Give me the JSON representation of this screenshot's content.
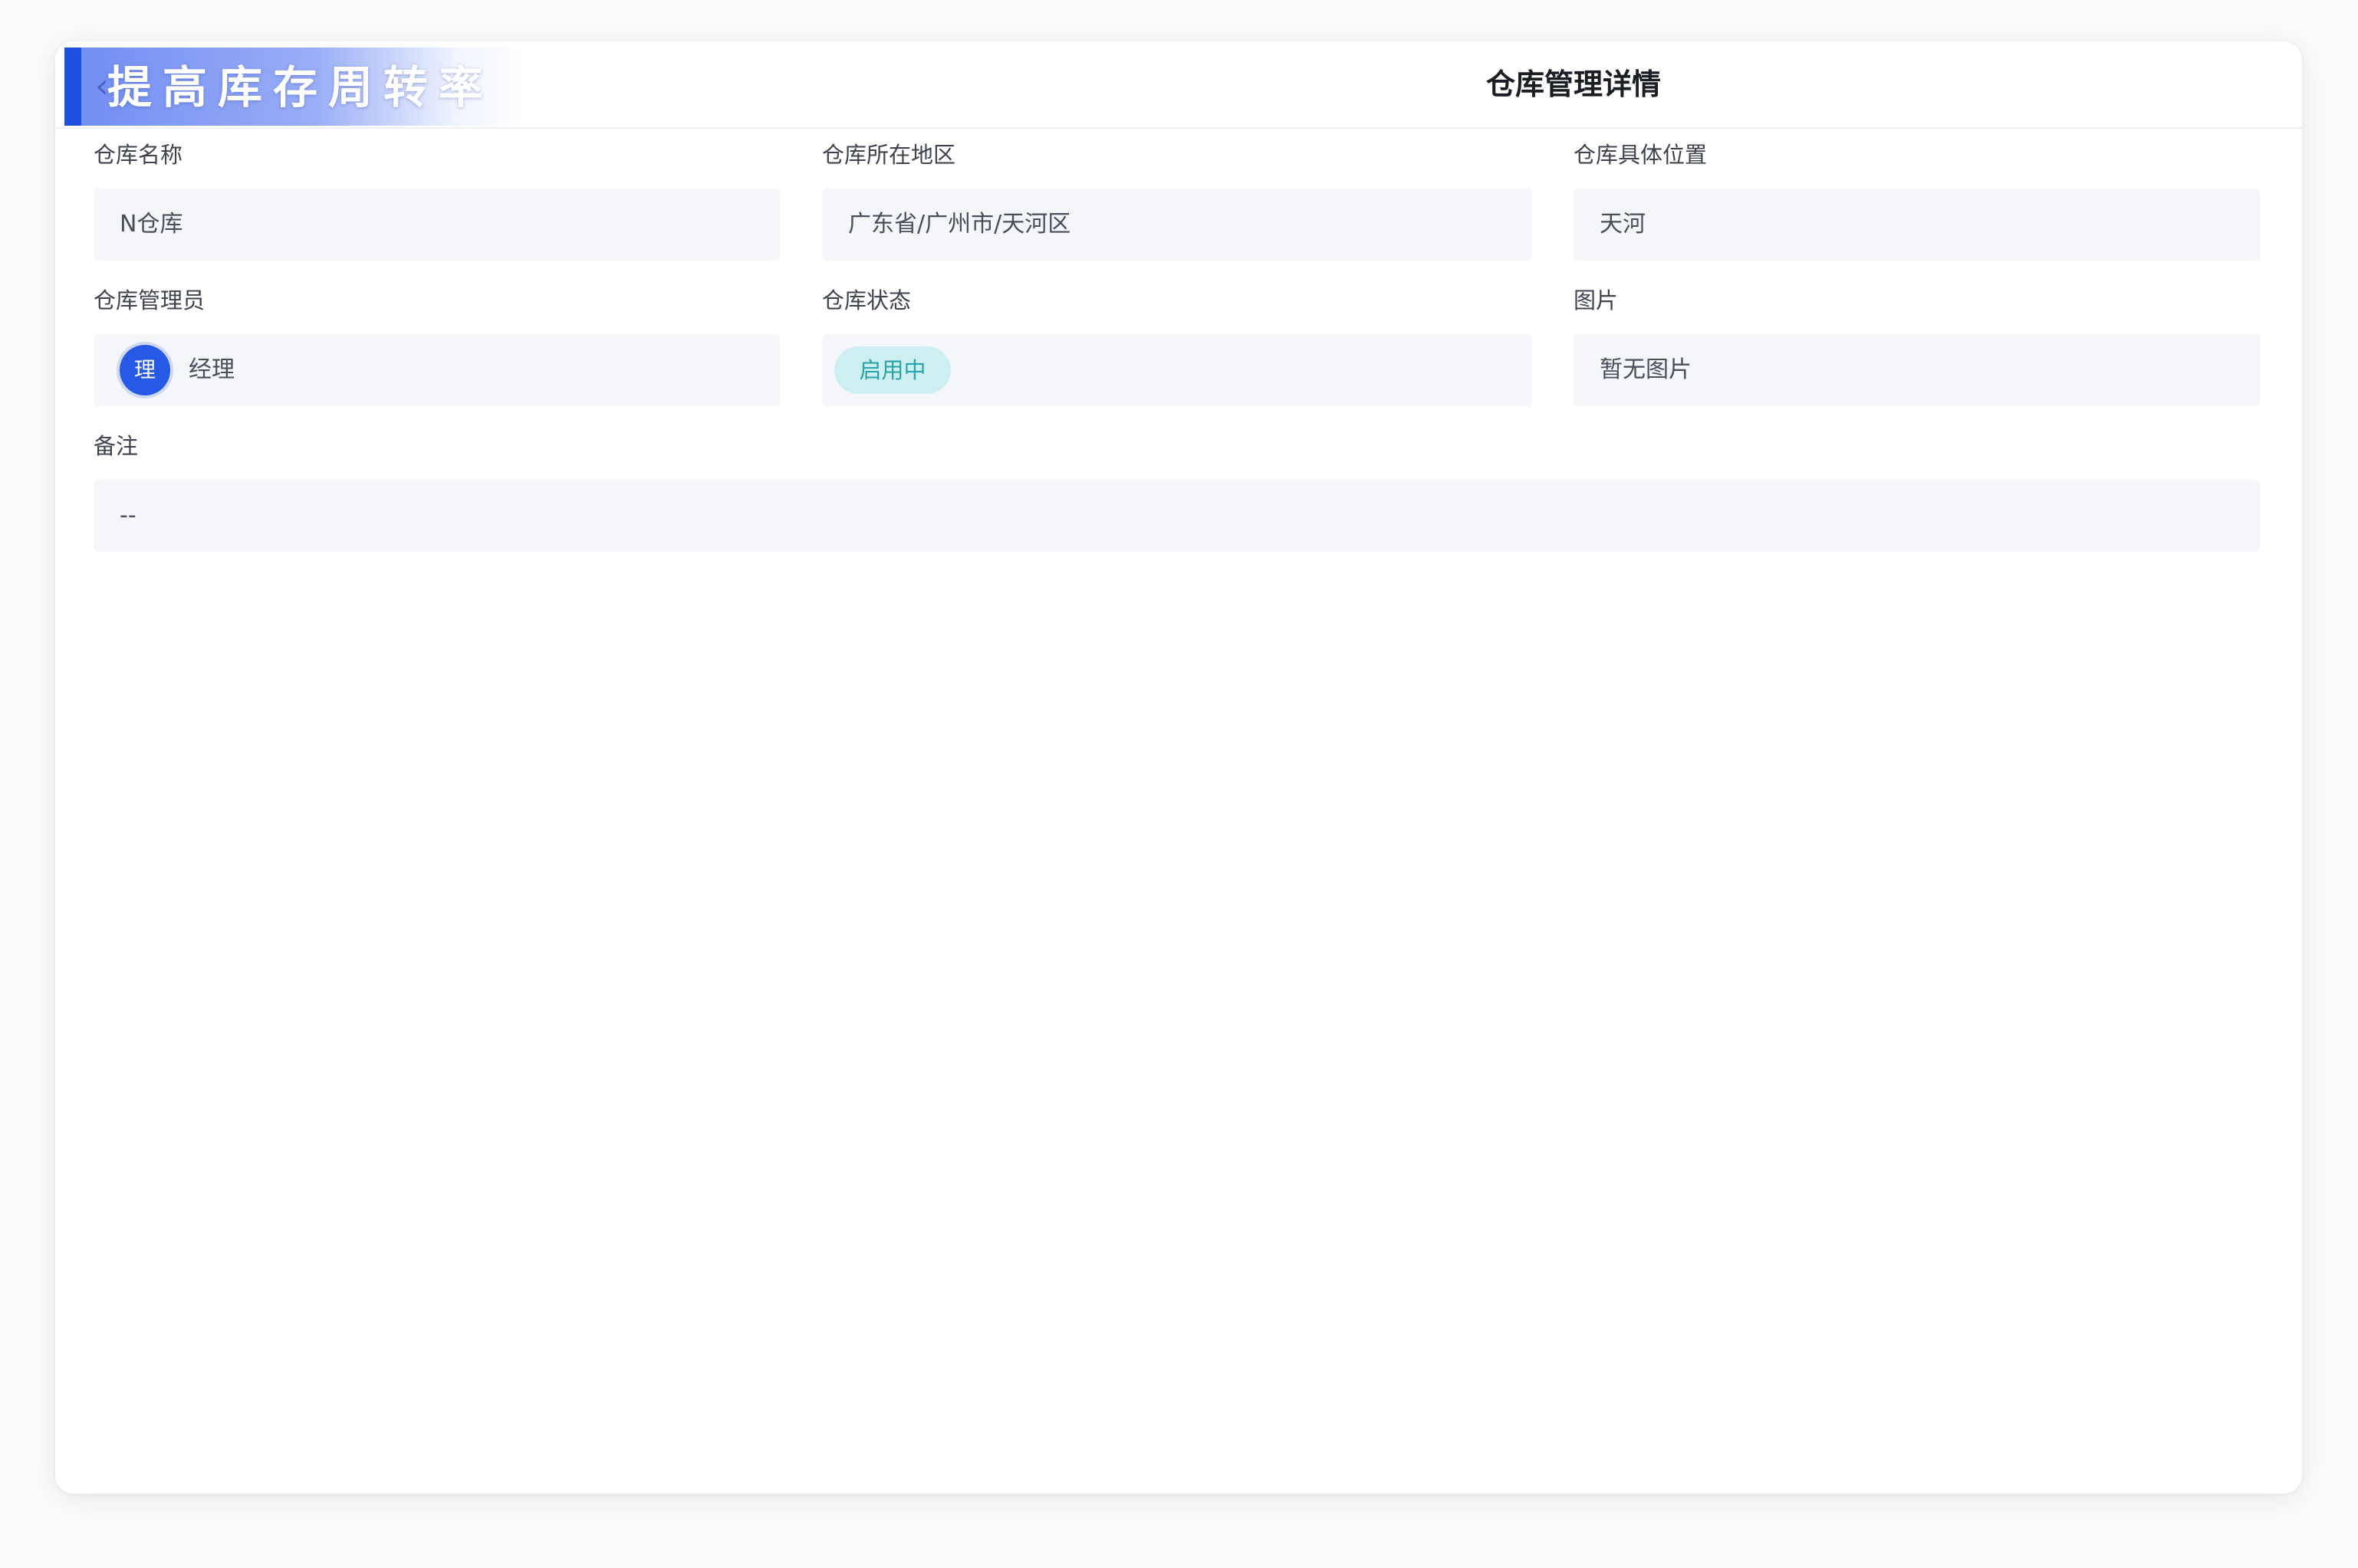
{
  "header": {
    "banner_text": "提高库存周转率",
    "back_icon": "‹",
    "title": "仓库管理详情"
  },
  "fields": {
    "warehouse_name": {
      "label": "仓库名称",
      "value": "N仓库"
    },
    "region": {
      "label": "仓库所在地区",
      "value": "广东省/广州市/天河区"
    },
    "location": {
      "label": "仓库具体位置",
      "value": "天河"
    },
    "manager": {
      "label": "仓库管理员",
      "avatar_text": "理",
      "value": "经理"
    },
    "status": {
      "label": "仓库状态",
      "value": "启用中"
    },
    "image": {
      "label": "图片",
      "value": "暂无图片"
    },
    "remark": {
      "label": "备注",
      "value": "--"
    }
  },
  "colors": {
    "accent": "#1f4fe0",
    "avatar": "#2659e6",
    "status_bg": "#cdeff0",
    "status_text": "#2aa3a8",
    "field_bg": "#f5f6fa"
  }
}
